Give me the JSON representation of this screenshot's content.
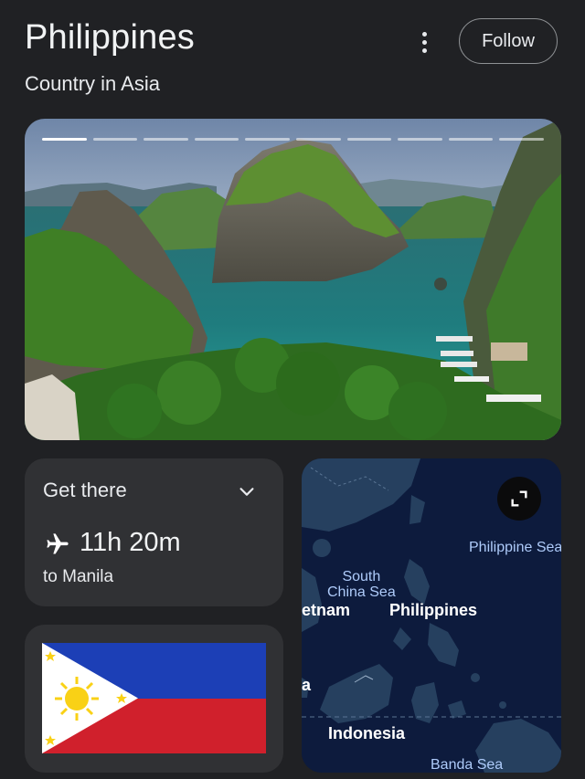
{
  "header": {
    "title": "Philippines",
    "subtitle": "Country in Asia",
    "follow_label": "Follow"
  },
  "hero": {
    "slide_count": 10,
    "active_slide": 1
  },
  "get_there": {
    "label": "Get there",
    "duration": "11h 20m",
    "destination": "to Manila"
  },
  "map": {
    "labels": {
      "philippine_sea": "Philippine Sea",
      "south_china_sea_1": "South",
      "south_china_sea_2": "China Sea",
      "vietnam": "etnam",
      "philippines": "Philippines",
      "partial_a": "a",
      "indonesia": "Indonesia",
      "banda_sea": "Banda Sea"
    }
  },
  "icons": {
    "more": "more-vert-icon",
    "chevron": "chevron-down-icon",
    "plane": "airplane-icon",
    "expand": "fullscreen-icon"
  },
  "colors": {
    "background": "#202124",
    "card": "#303134",
    "flag_blue": "#1c3fb6",
    "flag_red": "#d0202c",
    "flag_yellow": "#f9d116",
    "map_water": "#0d1b3d",
    "map_land": "#26405f",
    "map_label": "#aecbfa"
  }
}
